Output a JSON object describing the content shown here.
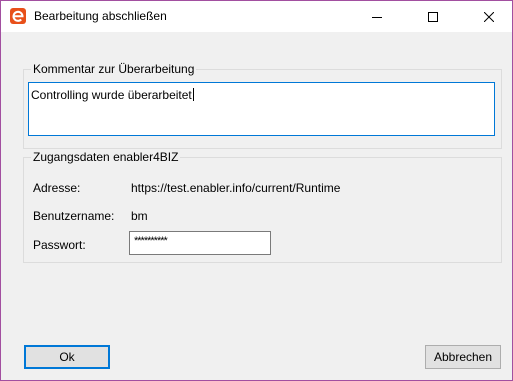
{
  "window": {
    "title": "Bearbeitung abschließen",
    "controls": {
      "minimize": "minimize-icon",
      "maximize": "maximize-icon",
      "close": "close-icon"
    },
    "app_icon": "enabler-logo-icon",
    "accent_color": "#e8501a"
  },
  "comment_group": {
    "legend": "Kommentar zur Überarbeitung",
    "value": "Controlling wurde überarbeitet"
  },
  "access_group": {
    "legend": "Zugangsdaten enabler4BIZ",
    "address_label": "Adresse:",
    "address_value": "https://test.enabler.info/current/Runtime",
    "username_label": "Benutzername:",
    "username_value": "bm",
    "password_label": "Passwort:",
    "password_value": "**********"
  },
  "buttons": {
    "ok": "Ok",
    "cancel": "Abbrechen"
  }
}
